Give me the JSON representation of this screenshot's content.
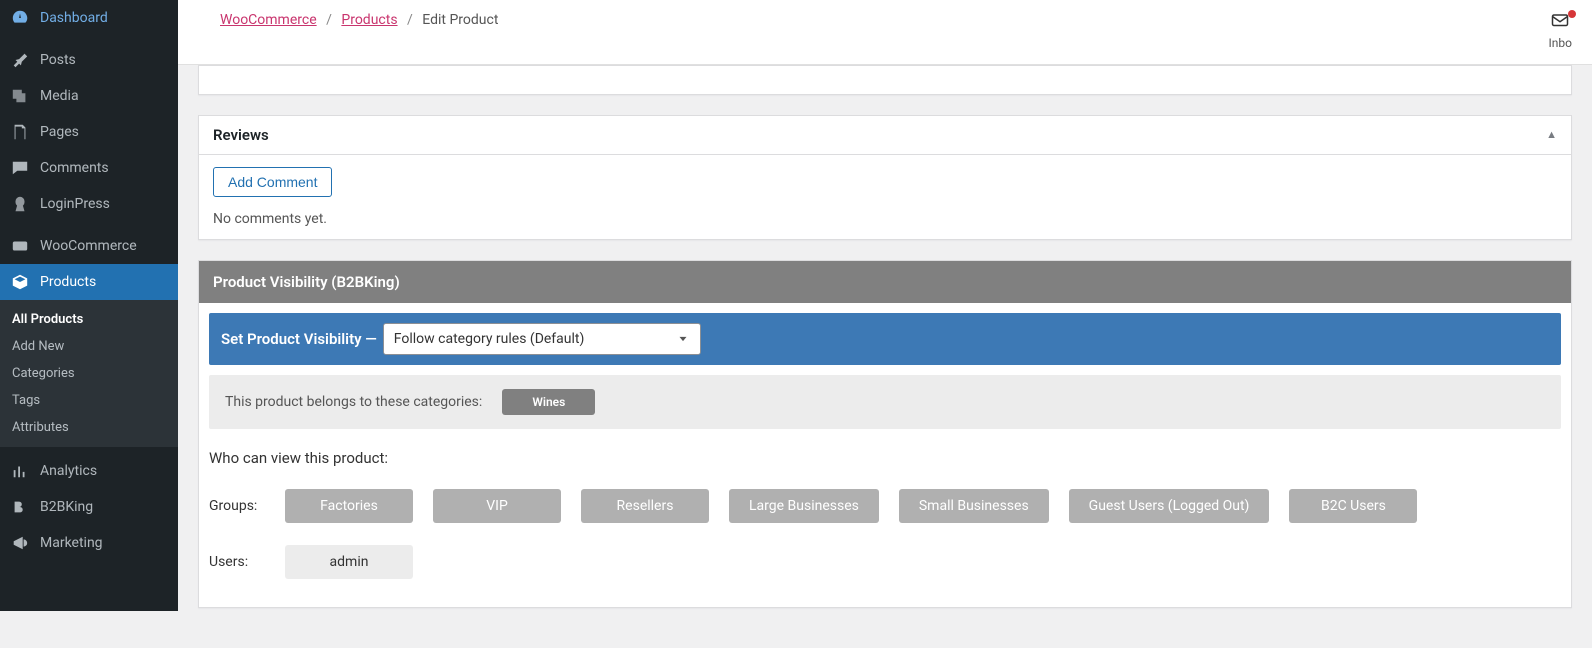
{
  "sidebar": {
    "items": {
      "dashboard": "Dashboard",
      "posts": "Posts",
      "media": "Media",
      "pages": "Pages",
      "comments": "Comments",
      "loginpress": "LoginPress",
      "woocommerce": "WooCommerce",
      "products": "Products",
      "analytics": "Analytics",
      "b2bking": "B2BKing",
      "marketing": "Marketing"
    },
    "products_sub": {
      "all": "All Products",
      "add": "Add New",
      "categories": "Categories",
      "tags": "Tags",
      "attributes": "Attributes"
    }
  },
  "breadcrumb": {
    "woocommerce": "WooCommerce",
    "products": "Products",
    "current": "Edit Product"
  },
  "inbox_label": "Inbo",
  "reviews": {
    "title": "Reviews",
    "add_btn": "Add Comment",
    "empty": "No comments yet."
  },
  "b2b": {
    "header": "Product Visibility (B2BKing)",
    "bar_label": "Set Product Visibility —",
    "select_value": "Follow category rules (Default)",
    "cat_label": "This product belongs to these categories:",
    "cat_chip": "Wines",
    "who_label": "Who can view this product:",
    "groups_label": "Groups:",
    "users_label": "Users:",
    "groups": [
      "Factories",
      "VIP",
      "Resellers",
      "Large Businesses",
      "Small Businesses",
      "Guest Users (Logged Out)",
      "B2C Users"
    ],
    "users": [
      "admin"
    ]
  }
}
